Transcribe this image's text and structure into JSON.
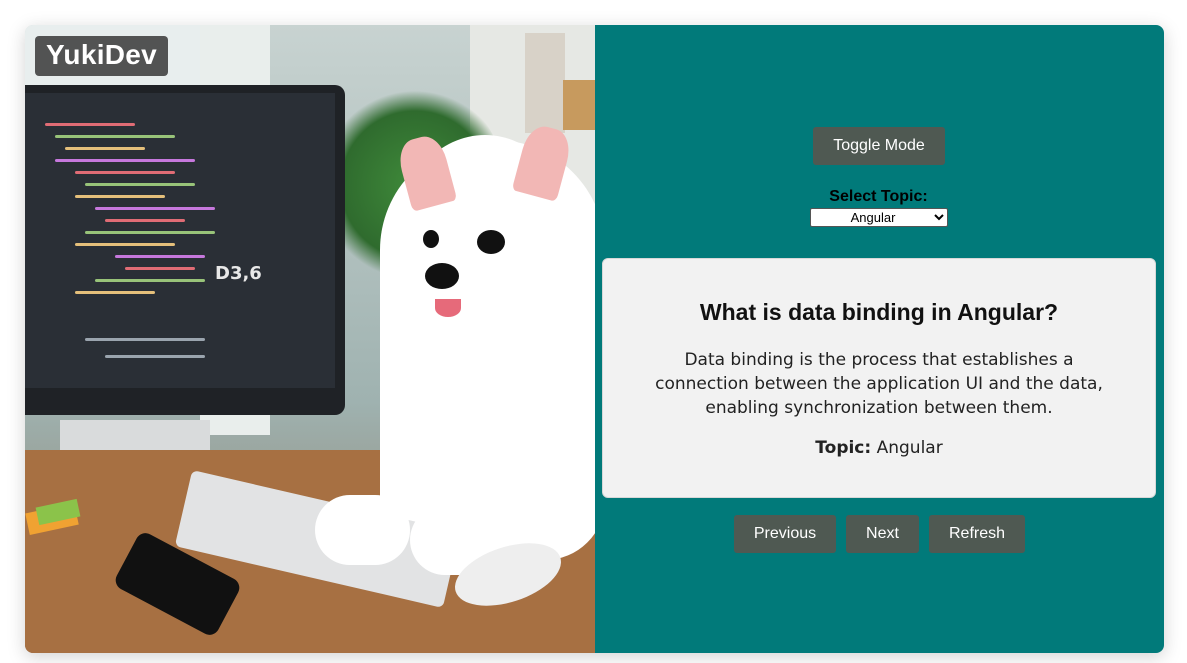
{
  "brand": {
    "logo_text": "YukiDev"
  },
  "illustration": {
    "alt": "White dog sitting at a desk in front of a computer monitor",
    "screen_text": "D3,6"
  },
  "controls": {
    "toggle_mode_label": "Toggle Mode",
    "select_topic_label": "Select Topic:",
    "selected_topic": "Angular",
    "topic_options": [
      "Angular"
    ]
  },
  "qa": {
    "question": "What is data binding in Angular?",
    "answer": "Data binding is the process that establishes a connection between the application UI and the data, enabling synchronization between them.",
    "topic_label": "Topic:",
    "topic_value": "Angular"
  },
  "nav": {
    "previous_label": "Previous",
    "next_label": "Next",
    "refresh_label": "Refresh"
  },
  "colors": {
    "panel_bg": "#017a7a",
    "button_bg": "#4f5952",
    "card_bg": "#f2f2f2"
  }
}
